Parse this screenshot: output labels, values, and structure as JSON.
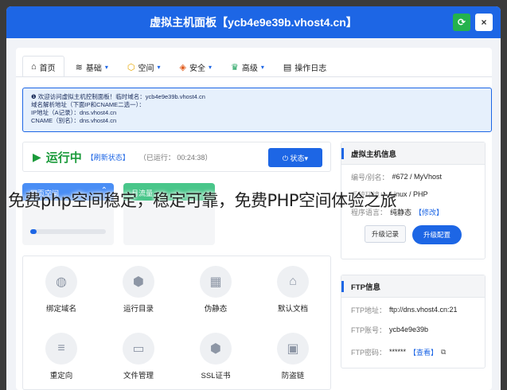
{
  "window": {
    "title": "虚拟主机面板【ycb4e9e39b.vhost4.cn】"
  },
  "titlebar_buttons": {
    "refresh": "⟳",
    "close": "×"
  },
  "nav": [
    {
      "label": "首页",
      "icon": "⌂"
    },
    {
      "label": "基础",
      "icon": "≋",
      "caret": "▾"
    },
    {
      "label": "空间",
      "icon": "⬡",
      "caret": "▾"
    },
    {
      "label": "安全",
      "icon": "◈",
      "caret": "▾"
    },
    {
      "label": "高级",
      "icon": "♛",
      "caret": "▾"
    },
    {
      "label": "操作日志",
      "icon": "▤"
    }
  ],
  "notice": {
    "line1": "❶ 欢迎访问虚拟主机控制面板！临时域名：ycb4e9e39b.vhost4.cn",
    "line2": "域名解析地址（下面IP和CNAME二选一）：",
    "line3": "IP地址（A记录）：dns.vhost4.cn",
    "line4": "CNAME（别名）：dns.vhost4.cn"
  },
  "status": {
    "running": "运行中",
    "refresh": "【刷新状态】",
    "uptime": "（已运行： 00:24:38）",
    "state_button": "⏻ 状态▾"
  },
  "usage": {
    "space_label": "网页空间",
    "space_fill": 0.08,
    "traffic_label": "月流量"
  },
  "tiles": [
    {
      "label": "绑定域名",
      "icon": "◍"
    },
    {
      "label": "运行目录",
      "icon": "⬢"
    },
    {
      "label": "伪静态",
      "icon": "▦"
    },
    {
      "label": "默认文档",
      "icon": "⌂"
    },
    {
      "label": "重定向",
      "icon": "≡"
    },
    {
      "label": "文件管理",
      "icon": "▭"
    },
    {
      "label": "SSL证书",
      "icon": "⬢"
    },
    {
      "label": "防盗链",
      "icon": "▣"
    }
  ],
  "host_card": {
    "title": "虚拟主机信息",
    "id_label": "编号/别名：",
    "id_value": "#672 / MyVhost",
    "env_label": "系统环境：",
    "env_value": "Linux / PHP",
    "lang_label": "程序语言：",
    "lang_value": "纯静态",
    "lang_link": "【修改】",
    "btn_history": "升级记录",
    "btn_upgrade": "升级配置"
  },
  "ftp_card": {
    "title": "FTP信息",
    "addr_label": "FTP地址：",
    "addr_value": "ftp://dns.vhost4.cn:21",
    "user_label": "FTP账号：",
    "user_value": "ycb4e9e39b",
    "pass_label": "FTP密码：",
    "pass_value": "******",
    "pass_link": "【查看】",
    "copy_icon": "⧉"
  },
  "overlay_caption": "免费php空间稳定，稳定可靠，免费PHP空间体验之旅"
}
